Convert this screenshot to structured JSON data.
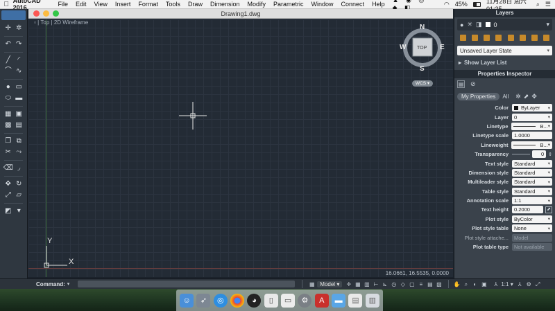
{
  "menubar": {
    "app_name": "AutoCAD 2016",
    "items": [
      "File",
      "Edit",
      "View",
      "Insert",
      "Format",
      "Tools",
      "Draw",
      "Dimension",
      "Modify",
      "Parametric",
      "Window",
      "Connect",
      "Help"
    ],
    "battery": "45%",
    "datetime": "11月28日 周六  01:25"
  },
  "window": {
    "title": "Drawing1.dwg",
    "view_label_1": "Top",
    "view_label_2": "2D Wireframe"
  },
  "viewcube": {
    "n": "N",
    "s": "S",
    "e": "E",
    "w": "W",
    "face": "TOP",
    "wcs": "WCS"
  },
  "ucs": {
    "y_label": "Y",
    "x_label": "X"
  },
  "coords": "16.0661, 16.5535, 0.0000",
  "layers": {
    "title": "Layers",
    "current_layer": "0",
    "layer_state": "Unsaved Layer State",
    "show_list": "Show Layer List"
  },
  "properties": {
    "title": "Properties Inspector",
    "tab_my_properties": "My Properties",
    "tab_all": "All",
    "rows": [
      {
        "label": "Color",
        "value": "ByLayer",
        "kind": "dd",
        "swatch": true
      },
      {
        "label": "Layer",
        "value": "0",
        "kind": "dd"
      },
      {
        "label": "Linetype",
        "value": "B...",
        "kind": "dd",
        "line": true
      },
      {
        "label": "Linetype scale",
        "value": "1.0000",
        "kind": "field"
      },
      {
        "label": "Lineweight",
        "value": "B...",
        "kind": "dd",
        "line": true
      },
      {
        "label": "Transparency",
        "value": "0",
        "kind": "spin"
      },
      {
        "label": "Text style",
        "value": "Standard",
        "kind": "dd"
      },
      {
        "label": "Dimension style",
        "value": "Standard",
        "kind": "dd"
      },
      {
        "label": "Multileader style",
        "value": "Standard",
        "kind": "dd"
      },
      {
        "label": "Table style",
        "value": "Standard",
        "kind": "dd"
      },
      {
        "label": "Annotation scale",
        "value": "1:1",
        "kind": "dd"
      },
      {
        "label": "Text height",
        "value": "0.2000",
        "kind": "field"
      },
      {
        "label": "Plot style",
        "value": "ByColor",
        "kind": "dd"
      },
      {
        "label": "Plot style table",
        "value": "None",
        "kind": "dd"
      },
      {
        "label": "Plot style attache...",
        "value": "Model",
        "kind": "disabled"
      },
      {
        "label": "Plot table type",
        "value": "Not available",
        "kind": "disabled"
      }
    ]
  },
  "command": {
    "label": "Command:"
  },
  "status": {
    "model": "Model",
    "scale": "1:1"
  }
}
